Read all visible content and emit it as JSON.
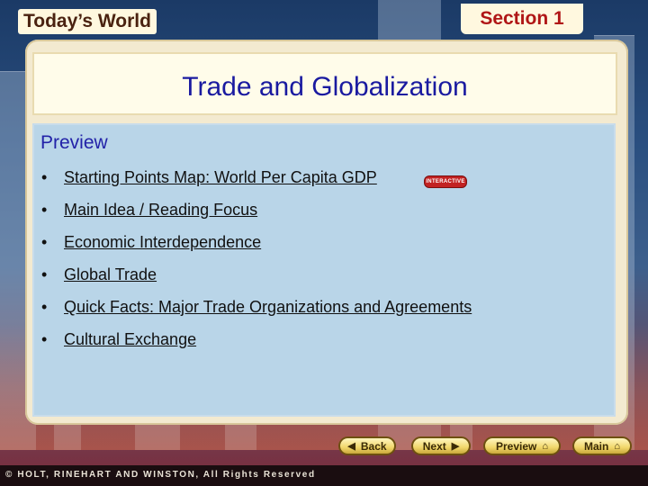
{
  "header": {
    "book_title": "Today’s World",
    "section": "Section 1"
  },
  "title": "Trade and Globalization",
  "preview": {
    "label": "Preview",
    "items": [
      {
        "bullet": "•",
        "label": "Starting Points Map: World Per Capita GDP"
      },
      {
        "bullet": "•",
        "label": "Main Idea / Reading Focus"
      },
      {
        "bullet": "•",
        "label": "Economic Interdependence"
      },
      {
        "bullet": "•",
        "label": "Global Trade"
      },
      {
        "bullet": "•",
        "label": "Quick Facts: Major Trade Organizations and Agreements"
      },
      {
        "bullet": "•",
        "label": "Cultural Exchange"
      }
    ],
    "interactive_badge": "INTERACTIVE"
  },
  "nav": {
    "back": "Back",
    "next": "Next",
    "preview": "Preview",
    "main": "Main"
  },
  "footer": {
    "copyright": "© HOLT, RINEHART AND WINSTON, All Rights Reserved"
  }
}
